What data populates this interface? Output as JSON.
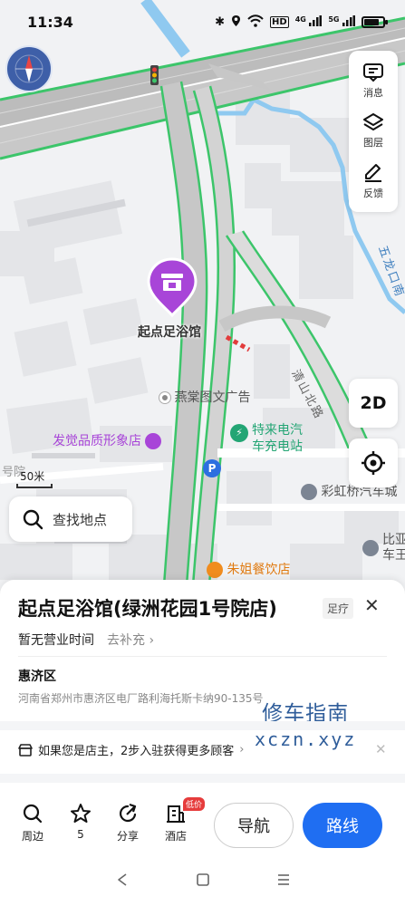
{
  "status_bar": {
    "time": "11:34",
    "net_labels": [
      "HD",
      "4G",
      "5G"
    ]
  },
  "map": {
    "scale_label": "50米",
    "search_placeholder": "查找地点",
    "marker_title": "起点足浴馆",
    "tools": [
      {
        "label": "消息",
        "icon": "message-icon"
      },
      {
        "label": "图层",
        "icon": "layers-icon"
      },
      {
        "label": "反馈",
        "icon": "feedback-icon"
      }
    ],
    "view_mode": "2D",
    "pois": {
      "yantang": "燕棠图文广告",
      "faju": "发觉品质形象店",
      "charging_1": "特来电汽",
      "charging_2": "车充电站",
      "caihong": "彩虹桥汽车城",
      "zhujie": "朱姐餐饮店",
      "bilong_1": "比亚",
      "bilong_2": "车王",
      "haohao": "号院",
      "road_qingshan": "清山北路",
      "road_wulong": "五龙口南"
    },
    "colors": {
      "marker": "#a845d8",
      "road_edge": "#3cc56a",
      "water": "#8fc9f0",
      "charging": "#23a574",
      "restaurant": "#f08c1e",
      "brand": "#1f6ef2"
    }
  },
  "place": {
    "title": "起点足浴馆(绿洲花园1号院店)",
    "category_tag": "足疗",
    "hours": "暂无营业时间",
    "supplement_link": "去补充",
    "district": "惠济区",
    "address": "河南省郑州市惠济区电厂路利海托斯卡纳90-135号",
    "owner_prompt": "如果您是店主，2步入驻获得更多顾客",
    "watermark_line1": "修车指南",
    "watermark_line2": "xczn.xyz"
  },
  "actions": [
    {
      "label": "周边",
      "icon": "search-icon"
    },
    {
      "label": "5",
      "icon": "star-icon"
    },
    {
      "label": "分享",
      "icon": "share-icon"
    },
    {
      "label": "酒店",
      "icon": "hotel-icon",
      "badge": "低价"
    }
  ],
  "nav_button": "导航",
  "route_button": "路线",
  "battery_level": 0.8
}
